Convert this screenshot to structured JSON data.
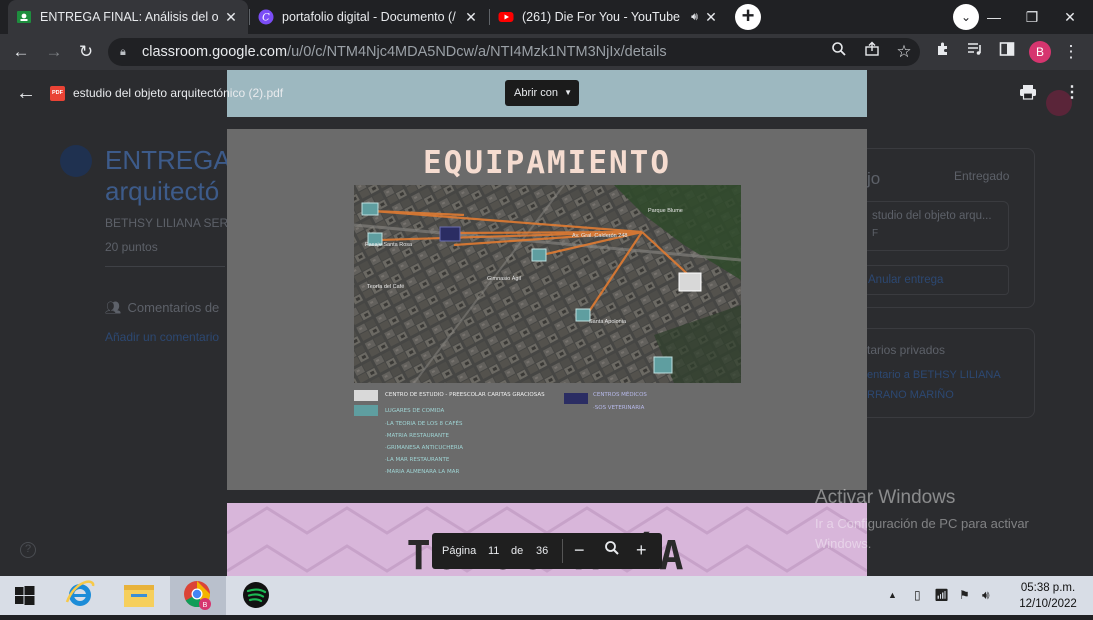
{
  "browser": {
    "tabs": [
      {
        "title": "ENTREGA FINAL: Análisis del obje",
        "close": "✕"
      },
      {
        "title": "portafolio digital - Documento (/",
        "close": "✕"
      },
      {
        "title": "(261) Die For You - YouTube",
        "close": "✕"
      }
    ],
    "new_tab": "+",
    "url_host": "classroom.google.com",
    "url_path": "/u/0/c/NTM4Njc4MDA5NDcw/a/NTI4Mzk1NTM3NjIx/details",
    "profile_initial": "B"
  },
  "classroom": {
    "title": "ENTREGA arquitectó",
    "author": "BETHSY LILIANA SERR",
    "points": "20 puntos",
    "comments_heading": "Comentarios de",
    "add_comment": "Añadir un comentario",
    "right_heading": "jo",
    "status": "Entregado",
    "attachment": "studio del objeto arqu...",
    "attachment_type": "F",
    "cancel": "Anular entrega",
    "private_heading": "tarios privados",
    "private_link_1": "entario a BETHSY LILIANA",
    "private_link_2": "RRANO MARIÑO",
    "help": "?"
  },
  "viewer": {
    "file_badge": "PDF",
    "file_name": "estudio del objeto arquitectónico (2).pdf",
    "open_with": "Abrir con",
    "page_label": "Página",
    "current_page": "11",
    "of_label": "de",
    "total_pages": "36",
    "zoom_out": "−",
    "zoom_in": "+"
  },
  "slide": {
    "title": "EQUIPAMIENTO",
    "map_labels": [
      "Parque Blume",
      "Av. Gral. Calderón 248",
      "Pasaje Santa Rosa",
      "Teoría del Café",
      "Gimnasio Ágil",
      "Santa Apolonia"
    ],
    "legend_left": [
      "CENTRO DE ESTUDIO - PREESCOLAR CARITAS GRACIOSAS",
      "LUGARES DE COMIDA",
      "·LA TEORIA DE LOS 8 CAFÉS",
      "·MATRIA RESTAURANTE",
      "·GRIMANESA ANTICUCHERIA",
      "·LA MAR RESTAURANTE",
      "·MARIA ALMENARA LA MAR"
    ],
    "legend_right": [
      "CENTROS MÉDICOS",
      "·SOS VETERINARIA"
    ],
    "next_title": "TOPOGRAFÍA"
  },
  "watermark": {
    "line1": "Activar Windows",
    "line2": "Ir a Configuración de PC para activar Windows."
  },
  "taskbar": {
    "time": "05:38 p.m.",
    "date": "12/10/2022"
  },
  "colors": {
    "slide_bg": "#6b6b6b",
    "title_peach": "#f5dcd0",
    "teal": "#5f9ea0",
    "navy": "#2b2d63",
    "route_orange": "#e07b32",
    "next_slide_pink": "#d8b6da"
  }
}
